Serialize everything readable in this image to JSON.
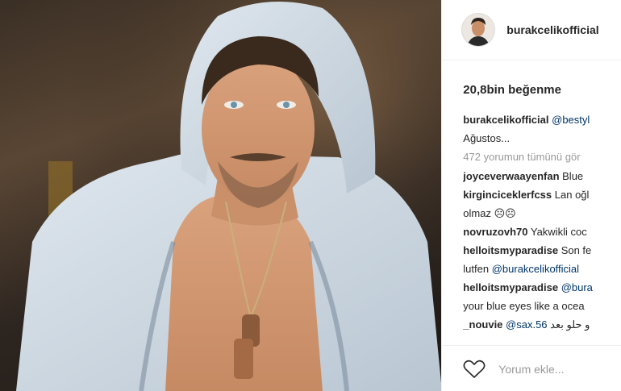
{
  "post": {
    "username": "burakcelikofficial",
    "likes": "20,8bin beğenme",
    "caption": {
      "user": "burakcelikofficial",
      "mention": "@bestyl",
      "text_line2": "Ağustos..."
    },
    "view_all": "472 yorumun tümünü gör",
    "comments": [
      {
        "user": "joyceverwaayenfan",
        "text": "Blue"
      },
      {
        "user": "kirginciceklerfcss",
        "text": "Lan oğl",
        "line2": "olmaz ☹☹"
      },
      {
        "user": "novruzovh70",
        "text": "Yakwikli coc"
      },
      {
        "user": "helloitsmyparadise",
        "text": "Son fe",
        "line2": "lutfen",
        "line2_mention": "@burakcelikofficial"
      },
      {
        "user": "helloitsmyparadise",
        "text": "",
        "mention": "@bura",
        "line2": "your blue eyes like a ocea"
      },
      {
        "user": "_nouvie",
        "mention": "@sax.56",
        "text": "و حلو بعد"
      }
    ],
    "add_comment_placeholder": "Yorum ekle..."
  },
  "colors": {
    "link": "#003569",
    "muted": "#999999",
    "text": "#262626"
  },
  "icons": {
    "like": "heart-icon"
  }
}
